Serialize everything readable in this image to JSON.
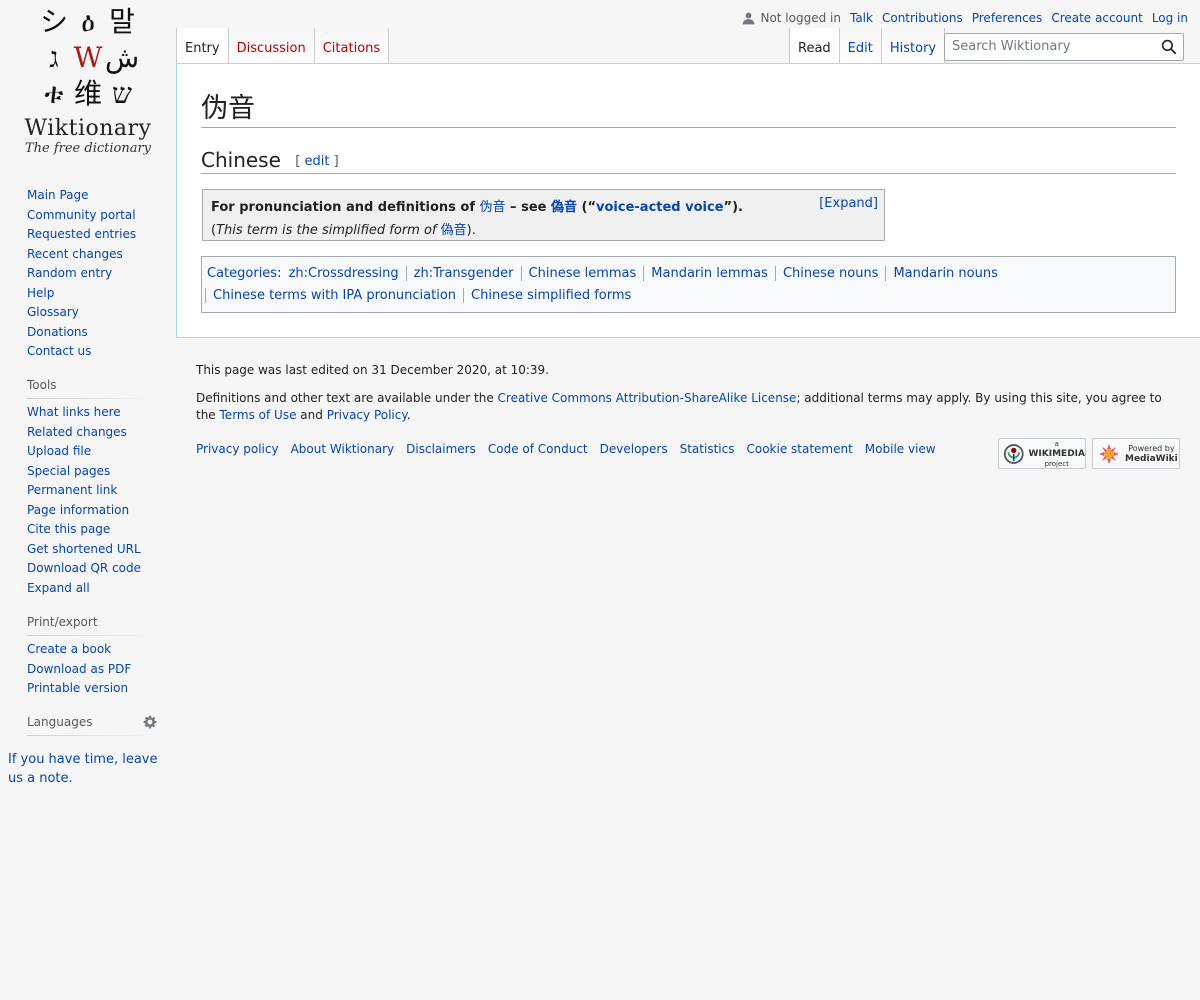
{
  "logo": {
    "glyphs": [
      "シ",
      "ዕ",
      "말",
      "ג",
      "W",
      "ش",
      "ቱ",
      "维",
      "ש"
    ],
    "wordmark": "Wiktionary",
    "tagline": "The free dictionary"
  },
  "personal": {
    "not_logged_in": "Not logged in",
    "links": [
      "Talk",
      "Contributions",
      "Preferences",
      "Create account",
      "Log in"
    ]
  },
  "tabs": {
    "left": [
      {
        "label": "Entry",
        "selected": true
      },
      {
        "label": "Discussion",
        "new": true
      },
      {
        "label": "Citations",
        "new": true
      }
    ],
    "right": [
      {
        "label": "Read",
        "selected": true
      },
      {
        "label": "Edit"
      },
      {
        "label": "History"
      }
    ]
  },
  "search": {
    "placeholder": "Search Wiktionary"
  },
  "page": {
    "title": "伪音",
    "lang_heading": "Chinese",
    "edit_open": "[",
    "edit_label": "edit",
    "edit_close": "]"
  },
  "see_box": {
    "prefix": "For pronunciation and definitions of ",
    "term1": "伪音",
    "mid": " – see ",
    "term2": "偽音",
    "gloss_open": " (“",
    "gloss": "voice-acted voice",
    "gloss_close": "”).",
    "line2_open": "(",
    "line2_text": "This term is the simplified form of ",
    "line2_term": "偽音",
    "line2_close": ").",
    "expand": "[Expand]"
  },
  "categories": {
    "label": "Categories",
    "row1": [
      "zh:Crossdressing",
      "zh:Transgender",
      "Chinese lemmas",
      "Mandarin lemmas",
      "Chinese nouns",
      "Mandarin nouns"
    ],
    "row2": [
      "Chinese terms with IPA pronunciation",
      "Chinese simplified forms"
    ]
  },
  "sidebar": {
    "navigation": [
      "Main Page",
      "Community portal",
      "Requested entries",
      "Recent changes",
      "Random entry",
      "Help",
      "Glossary",
      "Donations",
      "Contact us"
    ],
    "tools_heading": "Tools",
    "tools": [
      "What links here",
      "Related changes",
      "Upload file",
      "Special pages",
      "Permanent link",
      "Page information",
      "Cite this page",
      "Get shortened URL",
      "Download QR code",
      "Expand all"
    ],
    "print_heading": "Print/export",
    "print": [
      "Create a book",
      "Download as PDF",
      "Printable version"
    ],
    "languages_heading": "Languages",
    "note": "If you have time, leave us a note."
  },
  "footer": {
    "last_modified": "This page was last edited on 31 December 2020, at 10:39.",
    "license_pre": "Definitions and other text are available under the ",
    "license_link": "Creative Commons Attribution-ShareAlike License",
    "license_mid": "; additional terms may apply. By using this site, you agree to the ",
    "terms_link": "Terms of Use",
    "license_and": " and ",
    "privacy_link": "Privacy Policy",
    "license_end": ".",
    "places": [
      "Privacy policy",
      "About Wiktionary",
      "Disclaimers",
      "Code of Conduct",
      "Developers",
      "Statistics",
      "Cookie statement",
      "Mobile view"
    ],
    "wikimedia_badge": [
      "a",
      "WIKIMEDIA",
      "project"
    ],
    "mediawiki_badge": [
      "Powered by",
      "MediaWiki"
    ]
  },
  "colors": {
    "link": "#0645ad",
    "new_link": "#ba0000",
    "border": "#a7d7f9"
  }
}
